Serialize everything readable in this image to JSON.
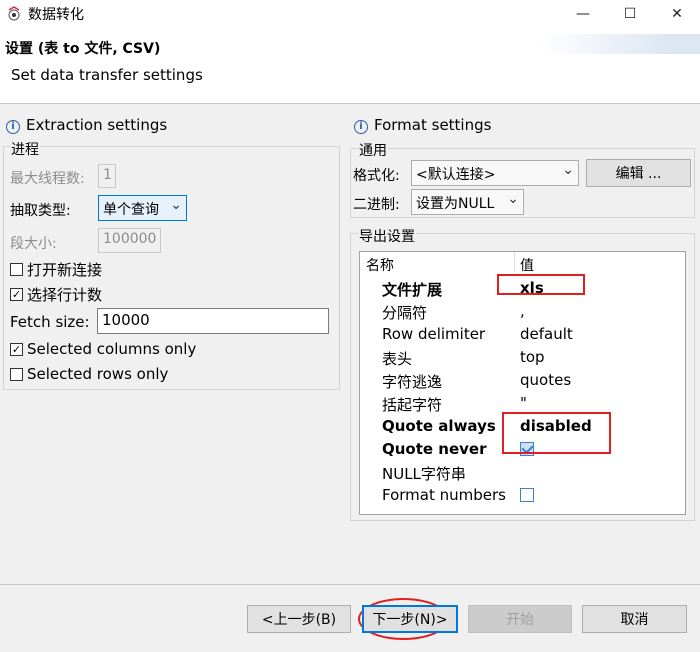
{
  "window": {
    "title": "数据转化",
    "minimize": "—",
    "maximize": "☐",
    "close": "✕"
  },
  "header": {
    "title": "设置 (表 to 文件, CSV)",
    "subtitle": "Set data transfer settings"
  },
  "extraction": {
    "title": "Extraction settings",
    "process_group": "进程",
    "max_threads_label": "最大线程数:",
    "max_threads_value": "1",
    "extract_type_label": "抽取类型:",
    "extract_type_value": "单个查询",
    "segment_size_label": "段大小:",
    "segment_size_value": "100000",
    "open_new_conn": {
      "label": "打开新连接",
      "checked": false
    },
    "select_row_count": {
      "label": "选择行计数",
      "checked": true
    },
    "fetch_size_label": "Fetch size:",
    "fetch_size_value": "10000",
    "selected_columns_only": {
      "label": "Selected columns only",
      "checked": true
    },
    "selected_rows_only": {
      "label": "Selected rows only",
      "checked": false
    }
  },
  "format": {
    "title": "Format settings",
    "general_group": "通用",
    "formatting_label": "格式化:",
    "formatting_value": "<默认连接>",
    "edit_button": "编辑 ...",
    "binary_label": "二进制:",
    "binary_value": "设置为NULL",
    "export_group": "导出设置",
    "table": {
      "col_name": "名称",
      "col_value": "值",
      "rows": [
        {
          "name": "文件扩展",
          "value": "xls",
          "bold": true
        },
        {
          "name": "分隔符",
          "value": ",",
          "bold": false
        },
        {
          "name": "Row delimiter",
          "value": "default",
          "bold": false
        },
        {
          "name": "表头",
          "value": "top",
          "bold": false
        },
        {
          "name": "字符逃逸",
          "value": "quotes",
          "bold": false
        },
        {
          "name": "括起字符",
          "value": "\"",
          "bold": false
        },
        {
          "name": "Quote always",
          "value": "disabled",
          "bold": true
        },
        {
          "name": "Quote never",
          "value": "",
          "checkbox": true,
          "checked": true,
          "bold": true
        },
        {
          "name": "NULL字符串",
          "value": "",
          "bold": false
        },
        {
          "name": "Format numbers",
          "value": "",
          "checkbox": true,
          "checked": false,
          "bold": false
        }
      ]
    }
  },
  "footer": {
    "back": "<上一步(B)",
    "next": "下一步(N)>",
    "start": "开始",
    "cancel": "取消"
  },
  "colors": {
    "annotation": "#e02020",
    "focus": "#0078d7"
  }
}
